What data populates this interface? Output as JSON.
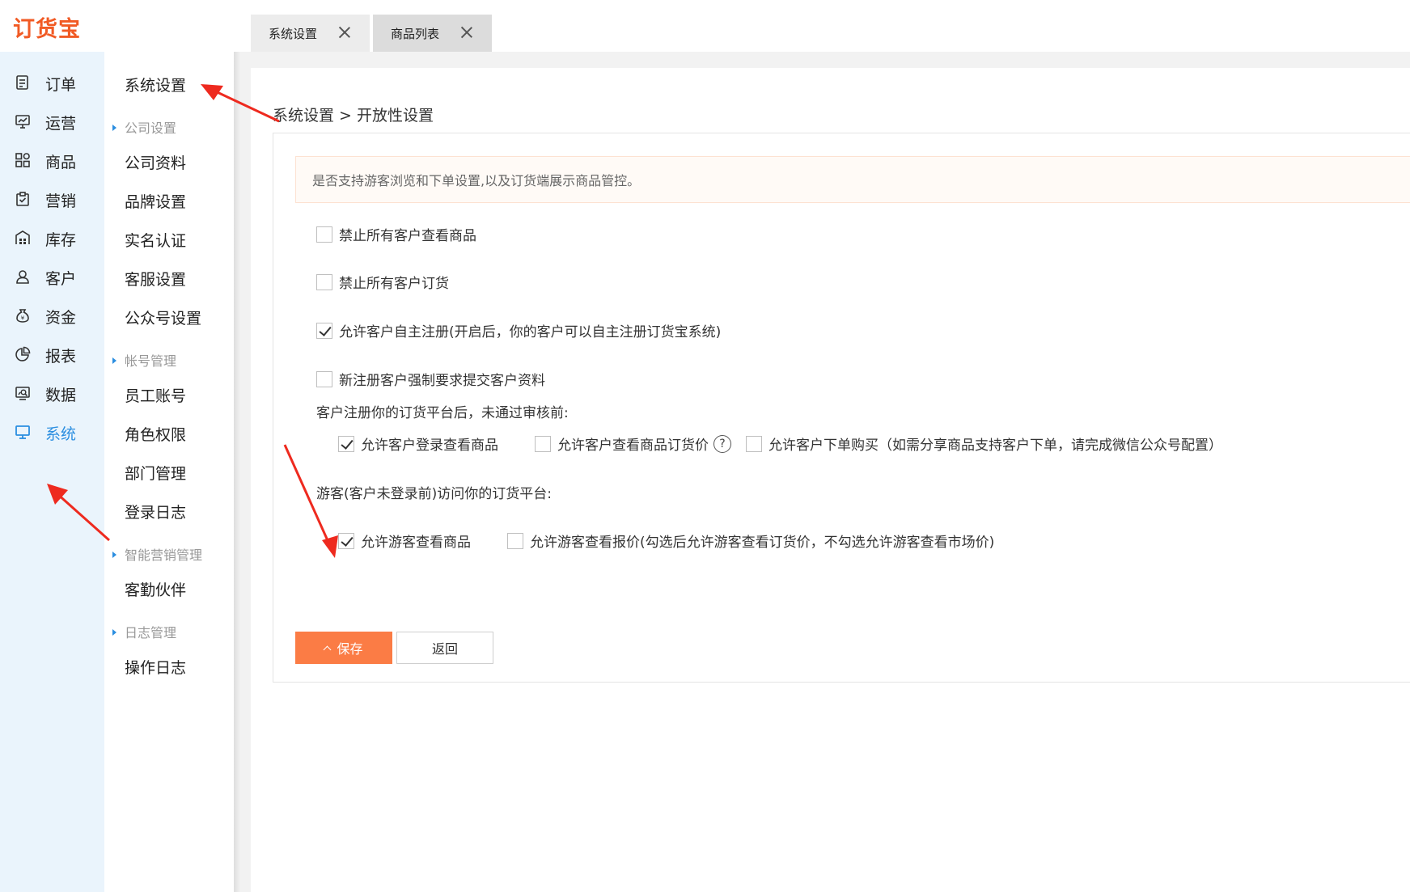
{
  "app": {
    "logo_text": "订货宝",
    "brand_color": "#f15a24",
    "accent_color": "#2b8ee0",
    "button_color": "#fb7c45"
  },
  "tabs": [
    {
      "label": "系统设置"
    },
    {
      "label": "商品列表"
    }
  ],
  "leftnav": [
    {
      "label": "订单",
      "icon": "order-icon"
    },
    {
      "label": "运营",
      "icon": "operation-icon"
    },
    {
      "label": "商品",
      "icon": "goods-icon"
    },
    {
      "label": "营销",
      "icon": "marketing-icon"
    },
    {
      "label": "库存",
      "icon": "warehouse-icon"
    },
    {
      "label": "客户",
      "icon": "user-icon"
    },
    {
      "label": "资金",
      "icon": "money-bag-icon"
    },
    {
      "label": "报表",
      "icon": "pie-chart-icon"
    },
    {
      "label": "数据",
      "icon": "data-icon"
    },
    {
      "label": "系统",
      "icon": "monitor-icon",
      "active": true
    }
  ],
  "subnav": {
    "title": "系统设置",
    "groups": [
      {
        "label": "公司设置",
        "items": [
          "公司资料",
          "品牌设置",
          "实名认证",
          "客服设置",
          "公众号设置"
        ]
      },
      {
        "label": "帐号管理",
        "items": [
          "员工账号",
          "角色权限",
          "部门管理",
          "登录日志"
        ]
      },
      {
        "label": "智能营销管理",
        "items": [
          "客勤伙伴"
        ]
      },
      {
        "label": "日志管理",
        "items": [
          "操作日志"
        ]
      }
    ]
  },
  "main": {
    "breadcrumb": "系统设置 > 开放性设置",
    "notice": "是否支持游客浏览和下单设置,以及订货端展示商品管控。",
    "options": [
      {
        "label": "禁止所有客户查看商品",
        "checked": false
      },
      {
        "label": "禁止所有客户订货",
        "checked": false
      },
      {
        "label": "允许客户自主注册(开启后，你的客户可以自主注册订货宝系统)",
        "checked": true
      },
      {
        "label": "新注册客户强制要求提交客户资料",
        "checked": false
      }
    ],
    "unreviewed_title": "客户注册你的订货平台后，未通过审核前:",
    "unreviewed_options": [
      {
        "label": "允许客户登录查看商品",
        "checked": true
      },
      {
        "label": "允许客户查看商品订货价",
        "checked": false,
        "help": "?"
      },
      {
        "label": "允许客户下单购买（如需分享商品支持客户下单，请完成微信公众号配置）",
        "checked": false
      }
    ],
    "guest_title": "游客(客户未登录前)访问你的订货平台:",
    "guest_options": [
      {
        "label": "允许游客查看商品",
        "checked": true
      },
      {
        "label": "允许游客查看报价(勾选后允许游客查看订货价，不勾选允许游客查看市场价)",
        "checked": false
      }
    ],
    "save_label": "保存",
    "back_label": "返回"
  }
}
